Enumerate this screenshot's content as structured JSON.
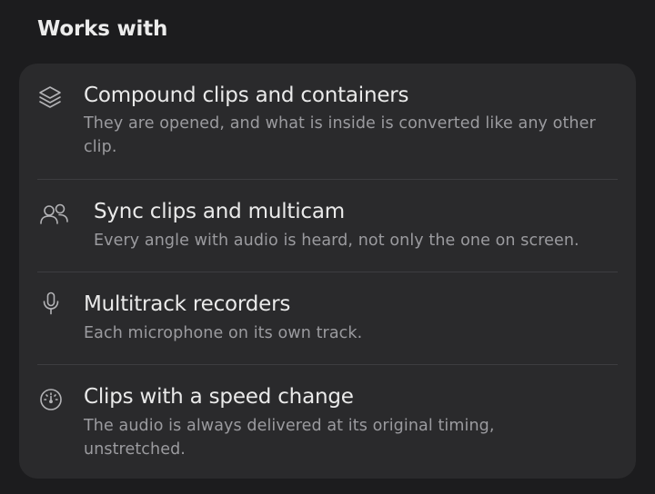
{
  "section": {
    "title": "Works with"
  },
  "items": [
    {
      "icon": "layers-icon",
      "title": "Compound clips and containers",
      "description": "They are opened, and what is inside is converted like any other clip."
    },
    {
      "icon": "people-icon",
      "title": "Sync clips and multicam",
      "description": "Every angle with audio is heard, not only the one on screen."
    },
    {
      "icon": "microphone-icon",
      "title": "Multitrack recorders",
      "description": "Each microphone on its own track."
    },
    {
      "icon": "speedometer-icon",
      "title": "Clips with a speed change",
      "description": "The audio is always delivered at its original timing, unstretched."
    }
  ]
}
